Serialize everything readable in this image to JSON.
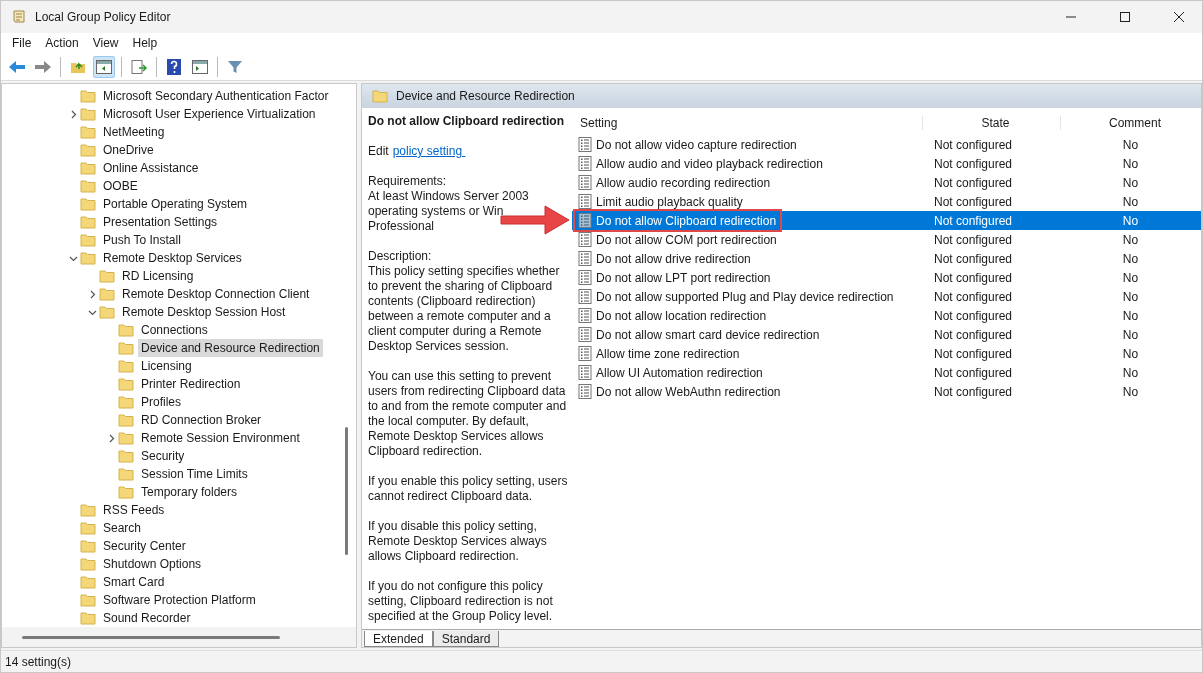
{
  "window": {
    "title": "Local Group Policy Editor"
  },
  "menu": [
    "File",
    "Action",
    "View",
    "Help"
  ],
  "tree": [
    {
      "label": "Microsoft Secondary Authentication Factor",
      "selected": false
    },
    {
      "label": "Microsoft User Experience Virtualization",
      "selected": false,
      "expanded": false
    },
    {
      "label": "NetMeeting",
      "selected": false
    },
    {
      "label": "OneDrive",
      "selected": false
    },
    {
      "label": "Online Assistance",
      "selected": false
    },
    {
      "label": "OOBE",
      "selected": false
    },
    {
      "label": "Portable Operating System",
      "selected": false
    },
    {
      "label": "Presentation Settings",
      "selected": false
    },
    {
      "label": "Push To Install",
      "selected": false
    },
    {
      "label": "Remote Desktop Services",
      "selected": false,
      "expanded": true,
      "children": [
        {
          "label": "RD Licensing",
          "selected": false
        },
        {
          "label": "Remote Desktop Connection Client",
          "selected": false,
          "expanded": false
        },
        {
          "label": "Remote Desktop Session Host",
          "selected": false,
          "expanded": true,
          "children": [
            {
              "label": "Connections",
              "selected": false
            },
            {
              "label": "Device and Resource Redirection",
              "selected": true
            },
            {
              "label": "Licensing",
              "selected": false
            },
            {
              "label": "Printer Redirection",
              "selected": false
            },
            {
              "label": "Profiles",
              "selected": false
            },
            {
              "label": "RD Connection Broker",
              "selected": false
            },
            {
              "label": "Remote Session Environment",
              "selected": false,
              "expanded": false
            },
            {
              "label": "Security",
              "selected": false
            },
            {
              "label": "Session Time Limits",
              "selected": false
            },
            {
              "label": "Temporary folders",
              "selected": false
            }
          ]
        }
      ]
    },
    {
      "label": "RSS Feeds",
      "selected": false
    },
    {
      "label": "Search",
      "selected": false
    },
    {
      "label": "Security Center",
      "selected": false
    },
    {
      "label": "Shutdown Options",
      "selected": false
    },
    {
      "label": "Smart Card",
      "selected": false
    },
    {
      "label": "Software Protection Platform",
      "selected": false
    },
    {
      "label": "Sound Recorder",
      "selected": false
    }
  ],
  "detail": {
    "header": "Device and Resource Redirection",
    "title": "Do not allow Clipboard redirection",
    "edit_prefix": "Edit",
    "edit_link": "policy setting ",
    "requirements": [
      "Requirements:",
      "At least Windows Server 2003",
      "operating systems or Win",
      "Professional"
    ],
    "paragraphs": [
      "Description:\nThis policy setting specifies whether to prevent the sharing of Clipboard contents (Clipboard redirection) between a remote computer and a client computer during a Remote Desktop Services session.",
      "You can use this setting to prevent users from redirecting Clipboard data to and from the remote computer and the local computer. By default, Remote Desktop Services allows Clipboard redirection.",
      "If you enable this policy setting, users cannot redirect Clipboard data.",
      "If you disable this policy setting, Remote Desktop Services always allows Clipboard redirection.",
      "If you do not configure this policy setting, Clipboard redirection is not specified at the Group Policy level."
    ]
  },
  "table": {
    "columns": [
      "Setting",
      "State",
      "Comment"
    ],
    "rows": [
      {
        "setting": "Do not allow video capture redirection",
        "state": "Not configured",
        "comment": "No",
        "selected": false,
        "highlighted": false
      },
      {
        "setting": "Allow audio and video playback redirection",
        "state": "Not configured",
        "comment": "No",
        "selected": false,
        "highlighted": false
      },
      {
        "setting": "Allow audio recording redirection",
        "state": "Not configured",
        "comment": "No",
        "selected": false,
        "highlighted": false
      },
      {
        "setting": "Limit audio playback quality",
        "state": "Not configured",
        "comment": "No",
        "selected": false,
        "highlighted": false
      },
      {
        "setting": "Do not allow Clipboard redirection",
        "state": "Not configured",
        "comment": "No",
        "selected": true,
        "highlighted": true
      },
      {
        "setting": "Do not allow COM port redirection",
        "state": "Not configured",
        "comment": "No",
        "selected": false,
        "highlighted": false
      },
      {
        "setting": "Do not allow drive redirection",
        "state": "Not configured",
        "comment": "No",
        "selected": false,
        "highlighted": false
      },
      {
        "setting": "Do not allow LPT port redirection",
        "state": "Not configured",
        "comment": "No",
        "selected": false,
        "highlighted": false
      },
      {
        "setting": "Do not allow supported Plug and Play device redirection",
        "state": "Not configured",
        "comment": "No",
        "selected": false,
        "highlighted": false
      },
      {
        "setting": "Do not allow location redirection",
        "state": "Not configured",
        "comment": "No",
        "selected": false,
        "highlighted": false
      },
      {
        "setting": "Do not allow smart card device redirection",
        "state": "Not configured",
        "comment": "No",
        "selected": false,
        "highlighted": false
      },
      {
        "setting": "Allow time zone redirection",
        "state": "Not configured",
        "comment": "No",
        "selected": false,
        "highlighted": false
      },
      {
        "setting": "Allow UI Automation redirection",
        "state": "Not configured",
        "comment": "No",
        "selected": false,
        "highlighted": false
      },
      {
        "setting": "Do not allow WebAuthn redirection",
        "state": "Not configured",
        "comment": "No",
        "selected": false,
        "highlighted": false
      }
    ]
  },
  "view_tabs": [
    {
      "label": "Extended",
      "selected": true
    },
    {
      "label": "Standard",
      "selected": false
    }
  ],
  "status_bar": "14 setting(s)"
}
